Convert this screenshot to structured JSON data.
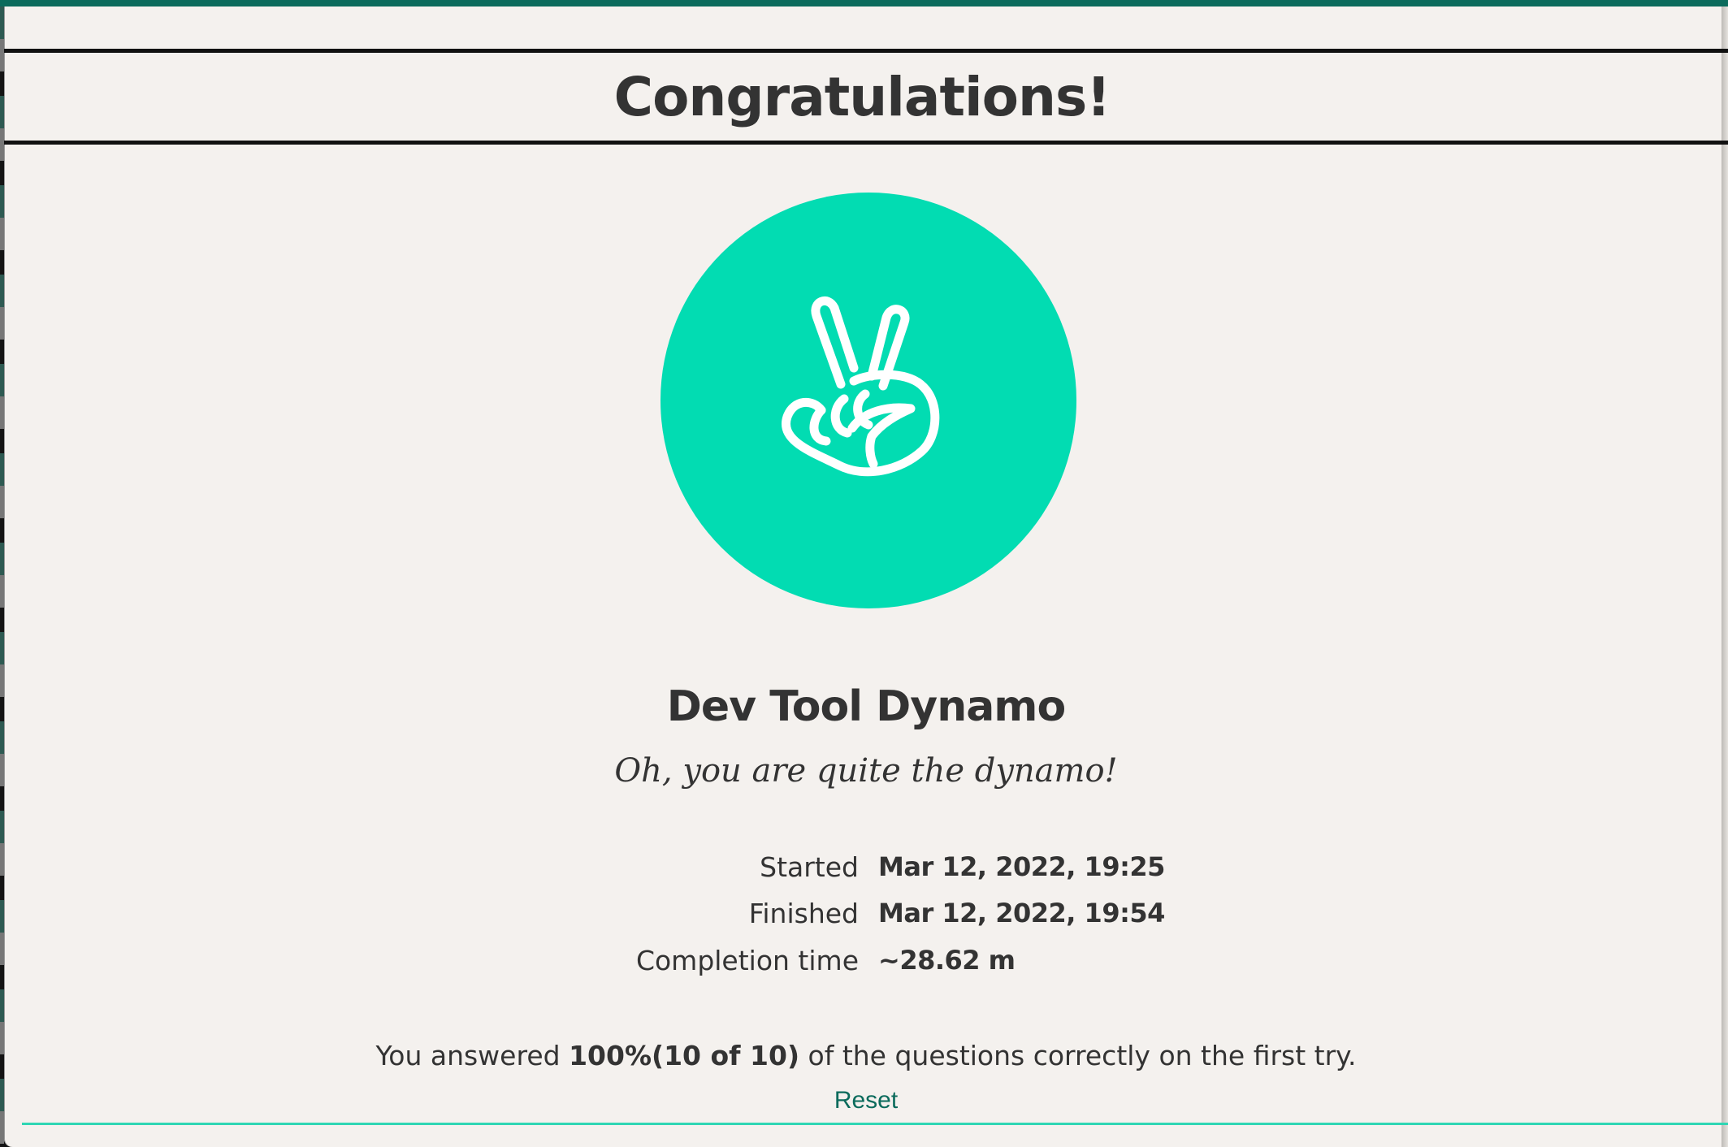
{
  "header": {
    "title": "Congratulations!"
  },
  "badge": {
    "icon": "peace-hand-icon",
    "circle_color": "#02dcb2",
    "title": "Dev Tool Dynamo",
    "subtitle": "Oh, you are quite the dynamo!"
  },
  "stats": [
    {
      "label": "Started",
      "value": "Mar 12, 2022, 19:25"
    },
    {
      "label": "Finished",
      "value": "Mar 12, 2022, 19:54"
    },
    {
      "label": "Completion time",
      "value": "~28.62 m"
    }
  ],
  "result": {
    "prefix": "You answered ",
    "score": "100%(10 of 10)",
    "suffix": " of the questions correctly on the first try."
  },
  "actions": {
    "reset_label": "Reset"
  },
  "colors": {
    "accent": "#0b6b5c",
    "badge": "#02dcb2",
    "rule": "#2fd6b4",
    "background": "#f4f1ee"
  }
}
